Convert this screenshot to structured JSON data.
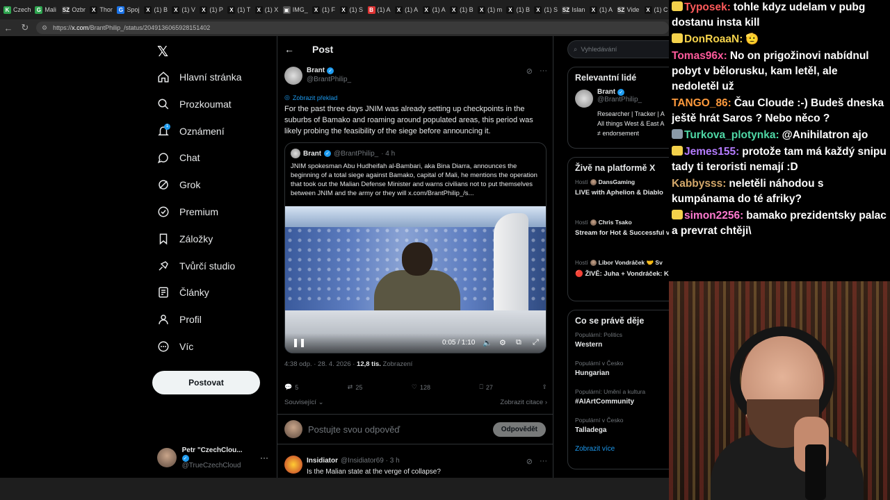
{
  "browser": {
    "tabs": [
      {
        "label": "Czech",
        "color": "#2ea44f",
        "icon": "K"
      },
      {
        "label": "Mali",
        "color": "#2ea44f",
        "icon": "G"
      },
      {
        "label": "Ozbr",
        "color": "#333333",
        "icon": "SZ"
      },
      {
        "label": "Thor",
        "color": "#111111",
        "icon": "X"
      },
      {
        "label": "Spoj",
        "color": "#1a73e8",
        "icon": "G"
      },
      {
        "label": "(1) B",
        "color": "#111111",
        "icon": "X"
      },
      {
        "label": "(1) V",
        "color": "#111111",
        "icon": "X"
      },
      {
        "label": "(1) P",
        "color": "#111111",
        "icon": "X"
      },
      {
        "label": "(1) T",
        "color": "#111111",
        "icon": "X"
      },
      {
        "label": "(1) X",
        "color": "#111111",
        "icon": "X"
      },
      {
        "label": "IMG_",
        "color": "#555555",
        "icon": "▣"
      },
      {
        "label": "(1) F",
        "color": "#111111",
        "icon": "X"
      },
      {
        "label": "(1) S",
        "color": "#111111",
        "icon": "X"
      },
      {
        "label": "(1) A",
        "color": "#d33",
        "icon": "B"
      },
      {
        "label": "(1) A",
        "color": "#111111",
        "icon": "X"
      },
      {
        "label": "(1) A",
        "color": "#111111",
        "icon": "X"
      },
      {
        "label": "(1) B",
        "color": "#111111",
        "icon": "X"
      },
      {
        "label": "(1) m",
        "color": "#111111",
        "icon": "X"
      },
      {
        "label": "(1) B",
        "color": "#111111",
        "icon": "X"
      },
      {
        "label": "(1) S",
        "color": "#111111",
        "icon": "X"
      },
      {
        "label": "Islan",
        "color": "#333333",
        "icon": "SZ"
      },
      {
        "label": "(1) A",
        "color": "#111111",
        "icon": "X"
      },
      {
        "label": "Vide",
        "color": "#333333",
        "icon": "SZ"
      },
      {
        "label": "(1) C",
        "color": "#111111",
        "icon": "X"
      }
    ],
    "url_prefix": "https://",
    "url_domain": "x.com",
    "url_path": "/BrantPhilip_/status/2049136065928151402"
  },
  "leftnav": {
    "logo": "𝕏",
    "items": [
      {
        "label": "Hlavní stránka"
      },
      {
        "label": "Prozkoumat"
      },
      {
        "label": "Oznámení"
      },
      {
        "label": "Chat"
      },
      {
        "label": "Grok"
      },
      {
        "label": "Premium"
      },
      {
        "label": "Záložky"
      },
      {
        "label": "Tvůrčí studio"
      },
      {
        "label": "Články"
      },
      {
        "label": "Profil"
      },
      {
        "label": "Víc"
      }
    ],
    "notification_badge": "1",
    "post_button": "Postovat",
    "account_name": "Petr \"CzechClou...",
    "account_handle": "@TrueCzechCloud",
    "account_more": "···"
  },
  "main": {
    "back": "←",
    "title": "Post",
    "tweet": {
      "name": "Brant",
      "handle": "@BrantPhilip_",
      "translate": "Zobrazit překlad",
      "text": "For the past three days JNIM was already setting up checkpoints in the suburbs of Bamako and roaming around populated areas, this period was likely probing the feasibility of the siege before announcing it.",
      "quote": {
        "name": "Brant",
        "handle": "@BrantPhilip_",
        "time": "· 4 h",
        "text": "JNIM spokesman Abu Hudheifah al-Bambari, aka Bina Diarra, announces the beginning of a total siege against Bamako, capital of Mali, he mentions the operation that took out the Malian Defense Minister and warns civilians not to put themselves between JNIM and the army or they will  x.com/BrantPhilip_/s..."
      },
      "video_time": "0:05 / 1:10",
      "meta_time": "4:38 odp. · 28. 4. 2026 · ",
      "meta_views": "12,8 tis.",
      "meta_views_label": " Zobrazení",
      "actions": {
        "replies": "5",
        "reposts": "25",
        "likes": "128",
        "bookmarks": "27"
      },
      "related": "Související ⌄",
      "quotes": "Zobrazit citace ›"
    },
    "reply_placeholder": "Postujte svou odpověď",
    "reply_button": "Odpovědět",
    "reply2": {
      "name": "Insidiator",
      "handle": "@Insidiator69 · 3 h",
      "text": "Is the Malian state at the verge of collapse?"
    }
  },
  "right": {
    "search_placeholder": "Vyhledávání",
    "relevant_title": "Relevantní lidé",
    "relevant_name": "Brant",
    "relevant_handle": "@BrantPhilip_",
    "relevant_bio_1": "Researcher | Tracker | A",
    "relevant_bio_2": "All things West & East A",
    "relevant_bio_3": "≠ endorsement",
    "live_title": "Živě na platformě X",
    "live": [
      {
        "host_label": "Hostí",
        "host": "DansGaming",
        "title": "LIVE with Aphelion & Diablo"
      },
      {
        "host_label": "Hostí",
        "host": "Chris Tsako",
        "title": "Stream for Hot & Successful viewers. Hearthstones! Clas"
      },
      {
        "host_label": "Hostí",
        "host": "Libor Vondráček 🤝 Sv",
        "title": "🔴 ŽIVĚ: Juha + Vondráček: Kůrovec pod kontrolou, ale …"
      }
    ],
    "trends_title": "Co se právě děje",
    "trends": [
      {
        "category": "Populární: Politics",
        "name": "Western"
      },
      {
        "category": "Populární v Česko",
        "name": "Hungarian"
      },
      {
        "category": "Populární: Umění a kultura",
        "name": "#AIArtCommunity"
      },
      {
        "category": "Populární v Česko",
        "name": "Talladega"
      }
    ],
    "show_more": "Zobrazit více"
  },
  "chat": [
    {
      "user": "Typosek:",
      "color": "#ff5a5a",
      "text": "tohle kdyz udelam v pubg dostanu insta kill",
      "badge": "#f3d14b"
    },
    {
      "user": "DonRoaaN:",
      "color": "#f3d14b",
      "text": "🫡",
      "badge": "#f3d14b"
    },
    {
      "user": "Tomas96x:",
      "color": "#ff5a9c",
      "text": "No on prigožinovi nabídnul pobyt v bělorusku, kam letěl, ale nedoletěl už",
      "badge": ""
    },
    {
      "user": "TANGO_86:",
      "color": "#ff9a3c",
      "text": "Čau Cloude :-) Budeš dneska ještě hrát Saros ? Nebo něco ?",
      "badge": ""
    },
    {
      "user": "Turkova_plotynka:",
      "color": "#4fd8a6",
      "text": "@Anihilatron ajo",
      "badge": "#8a9aa8"
    },
    {
      "user": "Jemes155:",
      "color": "#b57cff",
      "text": "protože tam má každý snipu tady ti teroristi nemají :D",
      "badge": "#f3d14b"
    },
    {
      "user": "Kabbysss:",
      "color": "#d4a86a",
      "text": "neletěli náhodou s kumpánama do té afriky?",
      "badge": ""
    },
    {
      "user": "simon2256:",
      "color": "#ff7ad0",
      "text": "bamako prezidentsky palac a prevrat chtěji\\",
      "badge": "#f3d14b"
    }
  ]
}
